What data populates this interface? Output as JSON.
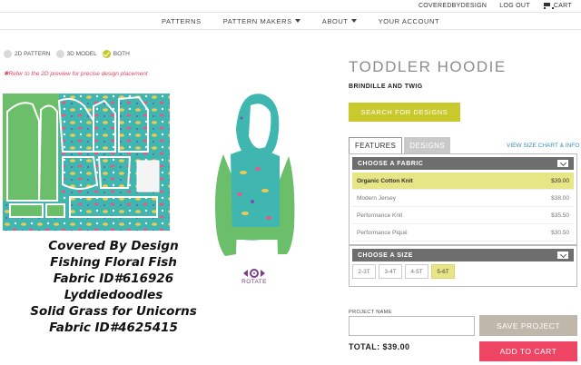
{
  "utility_nav": {
    "account": "COVEREDBYDESIGN",
    "logout": "LOG OUT",
    "cart": "CART"
  },
  "main_nav": {
    "items": [
      {
        "label": "PATTERNS"
      },
      {
        "label": "PATTERN MAKERS"
      },
      {
        "label": "ABOUT"
      },
      {
        "label": "YOUR ACCOUNT"
      }
    ]
  },
  "view_toggle": {
    "options": [
      {
        "label": "2D PATTERN",
        "selected": false
      },
      {
        "label": "3D MODEL",
        "selected": false
      },
      {
        "label": "BOTH",
        "selected": true
      }
    ],
    "note": "Refer to the 2D preview for precise design placement"
  },
  "rotate": {
    "label": "ROTATE"
  },
  "overlay_caption": {
    "lines": [
      "Covered By Design",
      "Fishing Floral Fish",
      "Fabric ID#616926",
      "Lyddiedoodles",
      "Solid Grass for Unicorns",
      "Fabric ID#4625415"
    ]
  },
  "product": {
    "title": "TODDLER HOODIE",
    "designer": "BRINDILLE AND TWIG",
    "search_button": "SEARCH FOR DESIGNS"
  },
  "tabs": {
    "items": [
      {
        "label": "FEATURES",
        "active": true
      },
      {
        "label": "DESIGNS",
        "active": false
      }
    ],
    "size_chart_link": "VIEW SIZE CHART & INFO"
  },
  "fabric": {
    "header": "CHOOSE A FABRIC",
    "options": [
      {
        "name": "Organic Cotton Knit",
        "price": "$39.00",
        "selected": true
      },
      {
        "name": "Modern Jersey",
        "price": "$38.00",
        "selected": false
      },
      {
        "name": "Performance Knit",
        "price": "$35.50",
        "selected": false
      },
      {
        "name": "Performance Piqué",
        "price": "$30.50",
        "selected": false
      }
    ]
  },
  "size": {
    "header": "CHOOSE A SIZE",
    "options": [
      {
        "label": "2-3T",
        "selected": false
      },
      {
        "label": "3-4T",
        "selected": false
      },
      {
        "label": "4-5T",
        "selected": false
      },
      {
        "label": "5-6T",
        "selected": true
      }
    ]
  },
  "project": {
    "label": "PROJECT NAME",
    "value": "",
    "save_button": "SAVE PROJECT"
  },
  "checkout": {
    "total": "TOTAL: $39.00",
    "add_to_cart": "ADD TO CART"
  },
  "colors": {
    "accent_yellow": "#c9c92e",
    "selected_highlight": "#e6e686",
    "cart_pink": "#ef4564",
    "save_tan": "#bfb7aa",
    "fabric_teal": "#3fb6b0",
    "grass_green": "#6cbf6a",
    "rotate_purple": "#7a3f87"
  }
}
